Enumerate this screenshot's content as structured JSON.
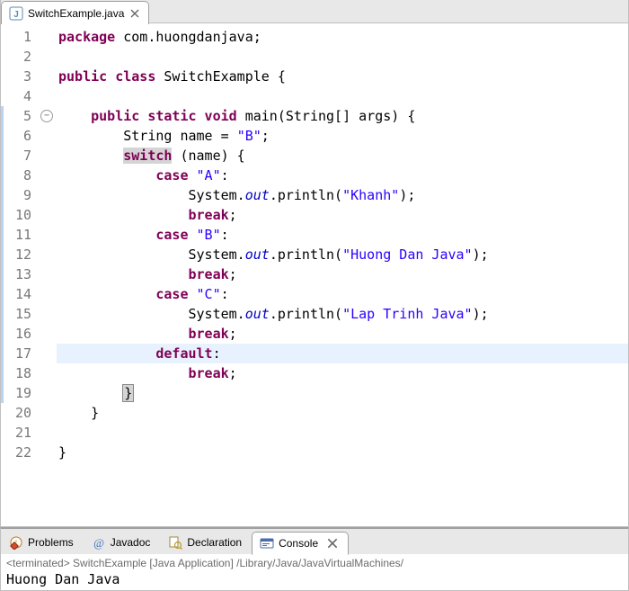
{
  "editor_tab": {
    "filename": "SwitchExample.java"
  },
  "code": {
    "lines": [
      {
        "n": "1",
        "t": [
          [
            "kw",
            "package"
          ],
          [
            "punc",
            " com.huongdanjava;"
          ]
        ]
      },
      {
        "n": "2",
        "t": [
          [
            "punc",
            ""
          ]
        ]
      },
      {
        "n": "3",
        "t": [
          [
            "kw",
            "public class"
          ],
          [
            "punc",
            " SwitchExample {"
          ]
        ]
      },
      {
        "n": "4",
        "t": [
          [
            "punc",
            ""
          ]
        ]
      },
      {
        "n": "5",
        "fold": true,
        "t": [
          [
            "punc",
            "    "
          ],
          [
            "kw",
            "public static void"
          ],
          [
            "punc",
            " main(String[] args) {"
          ]
        ]
      },
      {
        "n": "6",
        "t": [
          [
            "punc",
            "        String name = "
          ],
          [
            "str",
            "\"B\""
          ],
          [
            "punc",
            ";"
          ]
        ]
      },
      {
        "n": "7",
        "t": [
          [
            "punc",
            "        "
          ],
          [
            "swhl",
            "switch"
          ],
          [
            "punc",
            " (name) {"
          ]
        ]
      },
      {
        "n": "8",
        "t": [
          [
            "punc",
            "            "
          ],
          [
            "kw",
            "case"
          ],
          [
            "punc",
            " "
          ],
          [
            "str",
            "\"A\""
          ],
          [
            "punc",
            ":"
          ]
        ]
      },
      {
        "n": "9",
        "t": [
          [
            "punc",
            "                System."
          ],
          [
            "field",
            "out"
          ],
          [
            "punc",
            ".println("
          ],
          [
            "str",
            "\"Khanh\""
          ],
          [
            "punc",
            ");"
          ]
        ]
      },
      {
        "n": "10",
        "t": [
          [
            "punc",
            "                "
          ],
          [
            "kw",
            "break"
          ],
          [
            "punc",
            ";"
          ]
        ]
      },
      {
        "n": "11",
        "t": [
          [
            "punc",
            "            "
          ],
          [
            "kw",
            "case"
          ],
          [
            "punc",
            " "
          ],
          [
            "str",
            "\"B\""
          ],
          [
            "punc",
            ":"
          ]
        ]
      },
      {
        "n": "12",
        "t": [
          [
            "punc",
            "                System."
          ],
          [
            "field",
            "out"
          ],
          [
            "punc",
            ".println("
          ],
          [
            "str",
            "\"Huong Dan Java\""
          ],
          [
            "punc",
            ");"
          ]
        ]
      },
      {
        "n": "13",
        "t": [
          [
            "punc",
            "                "
          ],
          [
            "kw",
            "break"
          ],
          [
            "punc",
            ";"
          ]
        ]
      },
      {
        "n": "14",
        "t": [
          [
            "punc",
            "            "
          ],
          [
            "kw",
            "case"
          ],
          [
            "punc",
            " "
          ],
          [
            "str",
            "\"C\""
          ],
          [
            "punc",
            ":"
          ]
        ]
      },
      {
        "n": "15",
        "t": [
          [
            "punc",
            "                System."
          ],
          [
            "field",
            "out"
          ],
          [
            "punc",
            ".println("
          ],
          [
            "str",
            "\"Lap Trinh Java\""
          ],
          [
            "punc",
            ");"
          ]
        ]
      },
      {
        "n": "16",
        "t": [
          [
            "punc",
            "                "
          ],
          [
            "kw",
            "break"
          ],
          [
            "punc",
            ";"
          ]
        ]
      },
      {
        "n": "17",
        "hl": true,
        "t": [
          [
            "punc",
            "            "
          ],
          [
            "kw",
            "default"
          ],
          [
            "punc",
            ":"
          ]
        ]
      },
      {
        "n": "18",
        "t": [
          [
            "punc",
            "                "
          ],
          [
            "kw",
            "break"
          ],
          [
            "punc",
            ";"
          ]
        ]
      },
      {
        "n": "19",
        "t": [
          [
            "punc",
            "        "
          ],
          [
            "brace",
            "}"
          ]
        ]
      },
      {
        "n": "20",
        "t": [
          [
            "punc",
            "    }"
          ]
        ]
      },
      {
        "n": "21",
        "t": [
          [
            "punc",
            ""
          ]
        ]
      },
      {
        "n": "22",
        "t": [
          [
            "punc",
            "}"
          ]
        ]
      }
    ],
    "hl_lines_left_bar": [
      5,
      6,
      7,
      8,
      9,
      10,
      11,
      12,
      13,
      14,
      15,
      16,
      17,
      18,
      19
    ]
  },
  "bottom_tabs": {
    "problems": "Problems",
    "javadoc": "Javadoc",
    "declaration": "Declaration",
    "console": "Console"
  },
  "console": {
    "status": "<terminated> SwitchExample [Java Application] /Library/Java/JavaVirtualMachines/",
    "output": "Huong Dan Java"
  }
}
